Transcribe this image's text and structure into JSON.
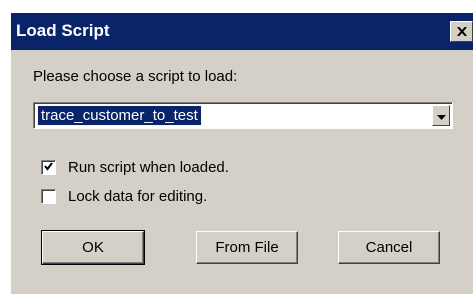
{
  "dialog": {
    "title": "Load Script",
    "close_icon": "close-icon",
    "prompt": "Please choose a script to load:",
    "script_select": {
      "selected_value": "trace_customer_to_test",
      "arrow_icon": "chevron-down-icon"
    },
    "options": [
      {
        "label": "Run script when loaded.",
        "checked": true
      },
      {
        "label": "Lock data for editing.",
        "checked": false
      }
    ],
    "buttons": {
      "ok": "OK",
      "from_file": "From File",
      "cancel": "Cancel"
    }
  },
  "colors": {
    "titlebar": "#0a246a",
    "face": "#d4d0c8",
    "selection": "#0a246a"
  }
}
